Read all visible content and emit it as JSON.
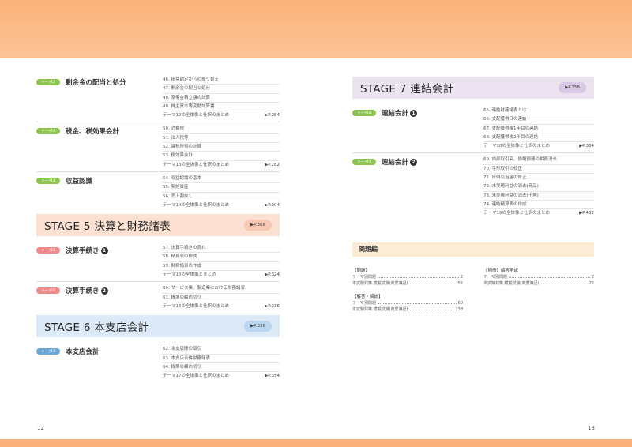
{
  "pages": {
    "left": "12",
    "right": "13"
  },
  "left": {
    "themes_top": [
      {
        "badge": "テーマ12",
        "title": "剰余金の配当と処分",
        "items": [
          "46. 損益勘定からの振り替え",
          "47. 剰余金の配当と処分",
          "48. 準備金積立額の計算",
          "49. 株主資本等変動計算書"
        ],
        "summary": "テーマ12の全体像と仕訳のまとめ",
        "page": "▶P.254"
      },
      {
        "badge": "テーマ13",
        "title": "税金、税効果会計",
        "items": [
          "50. 消費税",
          "51. 法人税等",
          "52. 課税所得の計算",
          "53. 税効果会計"
        ],
        "summary": "テーマ13の全体像と仕訳のまとめ",
        "page": "▶P.282"
      },
      {
        "badge": "テーマ14",
        "title": "収益認識",
        "items": [
          "54. 収益認識の基本",
          "55. 契約資産",
          "56. 売上割戻し"
        ],
        "summary": "テーマ14の全体像と仕訳のまとめ",
        "page": "▶P.304"
      }
    ],
    "stage5": {
      "title": "STAGE 5 決算と財務諸表",
      "page": "▶P.308"
    },
    "themes_stage5": [
      {
        "badge": "テーマ15",
        "title": "決算手続き",
        "num": "1",
        "items": [
          "57. 決算手続きの流れ",
          "58. 精算表の作成",
          "59. 財務諸表の作成"
        ],
        "summary": "テーマ15の全体像とまとめ",
        "page": "▶P.324"
      },
      {
        "badge": "テーマ16",
        "title": "決算手続き",
        "num": "2",
        "items": [
          "60. サービス業、製造業における財務諸表",
          "61. 帳簿の締め切り"
        ],
        "summary": "テーマ16の全体像と仕訳のまとめ",
        "page": "▶P.336"
      }
    ],
    "stage6": {
      "title": "STAGE 6 本支店会計",
      "page": "▶P.338"
    },
    "themes_stage6": [
      {
        "badge": "テーマ17",
        "title": "本支店会計",
        "items": [
          "62. 本支店間の取引",
          "63. 本支店合併財務諸表",
          "64. 帳簿の締め切り"
        ],
        "summary": "テーマ17の全体像と仕訳のまとめ",
        "page": "▶P.354"
      }
    ]
  },
  "right": {
    "stage7": {
      "title": "STAGE 7 連結会計",
      "page": "▶P.358"
    },
    "themes": [
      {
        "badge": "テーマ18",
        "title": "連結会計",
        "num": "1",
        "items": [
          "65. 連結財務諸表とは",
          "66. 支配獲得日の連結",
          "67. 支配獲得後1年目の連結",
          "68. 支配獲得後2年目の連結"
        ],
        "summary": "テーマ18の全体像と仕訳のまとめ",
        "page": "▶P.384"
      },
      {
        "badge": "テーマ19",
        "title": "連結会計",
        "num": "2",
        "items": [
          "69. 内部取引高、債権債務の相殺消去",
          "70. 手形取引の修正",
          "71. 貸倒引当金の修正",
          "72. 未実現利益の消去(商品)",
          "73. 未実現利益の消去(土地)",
          "74. 連結精算表の作成"
        ],
        "summary": "テーマ19の全体像と仕訳のまとめ",
        "page": "▶P.432"
      }
    ],
    "questions": {
      "header": "問題編",
      "groups_left": [
        {
          "head": "【問題】",
          "rows": [
            {
              "label": "テーマ別問題",
              "page": "2"
            },
            {
              "label": "本試験対策 模擬試験(商業簿記)",
              "page": "55"
            }
          ]
        },
        {
          "head": "【解答・解説】",
          "rows": [
            {
              "label": "テーマ別問題",
              "page": "60"
            },
            {
              "label": "本試験対策 模擬試験(商業簿記)",
              "page": "138"
            }
          ]
        }
      ],
      "groups_right": [
        {
          "head": "【別冊】解答用紙",
          "rows": [
            {
              "label": "テーマ別問題",
              "page": "2"
            },
            {
              "label": "本試験対策 模擬試験(商業簿記)",
              "page": "22"
            }
          ]
        }
      ]
    }
  }
}
